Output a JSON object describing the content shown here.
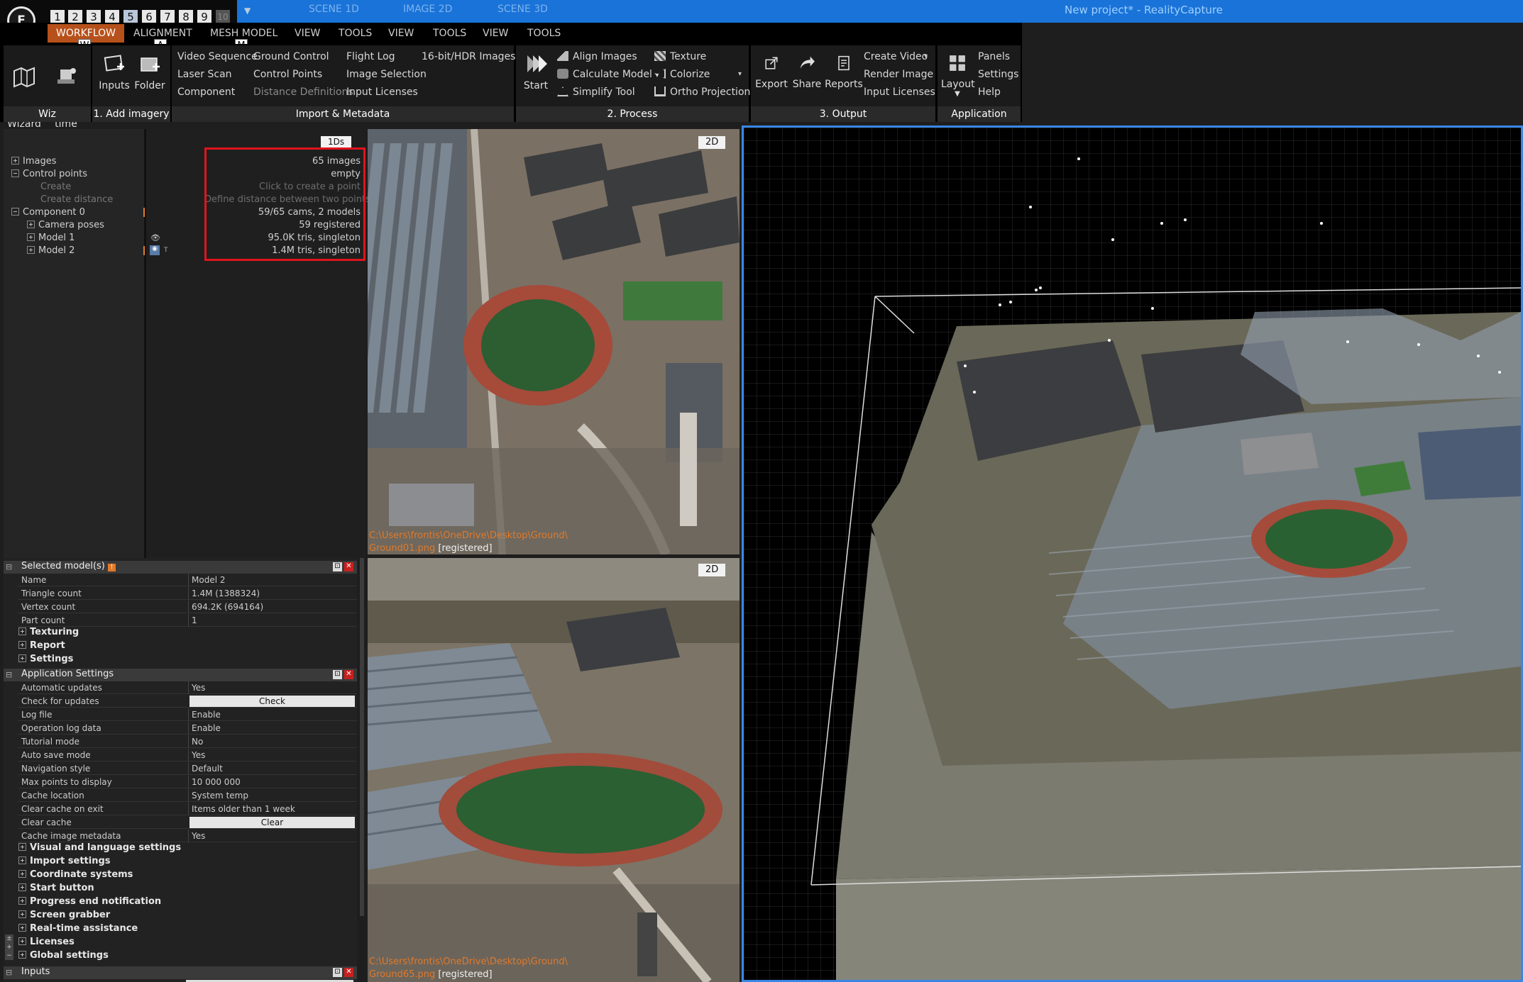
{
  "titlebar": {
    "logo": "F",
    "layout_tabs": [
      "1",
      "2",
      "3",
      "4",
      "5",
      "6",
      "7",
      "8",
      "9",
      "10"
    ],
    "scene_tabs": [
      "SCENE 1D",
      "IMAGE 2D",
      "SCENE 3D"
    ],
    "window_title": "New project* - RealityCapture"
  },
  "menubar": {
    "items": [
      "WORKFLOW",
      "ALIGNMENT",
      "MESH MODEL",
      "VIEW",
      "TOOLS",
      "VIEW",
      "TOOLS",
      "VIEW",
      "TOOLS"
    ],
    "hotkeys": [
      "W",
      "A",
      "M"
    ]
  },
  "ribbon": {
    "wiz": {
      "map_wizard": "Map\nWizard",
      "realtime_assistance": "Real-time\nAssistance",
      "footer": "Wiz"
    },
    "add_imagery": {
      "inputs": "Inputs",
      "folder": "Folder",
      "footer": "1. Add imagery"
    },
    "import_metadata": {
      "col1": [
        "Video Sequence",
        "Laser Scan",
        "Component"
      ],
      "col2": [
        "Ground Control",
        "Control Points",
        "Distance Definitions"
      ],
      "col3": [
        "Flight Log",
        "Image Selection",
        "Input Licenses"
      ],
      "col4": [
        "16-bit/HDR Images"
      ],
      "footer": "Import & Metadata"
    },
    "process": {
      "start": "Start",
      "col1": [
        "Align Images",
        "Calculate Model",
        "Simplify Tool"
      ],
      "col2": [
        "Texture",
        "Colorize",
        "Ortho Projection"
      ],
      "footer": "2. Process"
    },
    "output": {
      "export": "Export",
      "share": "Share",
      "reports": "Reports",
      "col": [
        "Create Video",
        "Render Image",
        "Input Licenses"
      ],
      "footer": "3. Output"
    },
    "application": {
      "layout": "Layout",
      "col": [
        "Panels",
        "Settings",
        "Help"
      ],
      "footer": "Application"
    }
  },
  "tree": {
    "tab": "1Ds",
    "rows": [
      {
        "label": "Images",
        "value": "65 images"
      },
      {
        "label": "Control points",
        "value": "empty"
      },
      {
        "label": "Create",
        "value": "Click to create a point"
      },
      {
        "label": "Create distance",
        "value": "Define distance between two points"
      },
      {
        "label": "Component 0",
        "value": "59/65 cams, 2 models"
      },
      {
        "label": "Camera poses",
        "value": "59 registered"
      },
      {
        "label": "Model 1",
        "value": "95.0K tris, singleton"
      },
      {
        "label": "Model 2",
        "value": "1.4M tris, singleton"
      }
    ]
  },
  "selected_model": {
    "title": "Selected model(s)",
    "rows": [
      {
        "key": "Name",
        "value": "Model 2"
      },
      {
        "key": "Triangle count",
        "value": "1.4M (1388324)"
      },
      {
        "key": "Vertex count",
        "value": "694.2K (694164)"
      },
      {
        "key": "Part count",
        "value": "1"
      }
    ],
    "sections": [
      "Texturing",
      "Report",
      "Settings"
    ]
  },
  "app_settings": {
    "title": "Application Settings",
    "rows": [
      {
        "key": "Automatic updates",
        "value": "Yes"
      },
      {
        "key": "Check for updates",
        "value": "Check",
        "button": true
      },
      {
        "key": "Log file",
        "value": "Enable"
      },
      {
        "key": "Operation log data",
        "value": "Enable"
      },
      {
        "key": "Tutorial mode",
        "value": "No"
      },
      {
        "key": "Auto save mode",
        "value": "Yes"
      },
      {
        "key": "Navigation style",
        "value": "Default"
      },
      {
        "key": "Max points to display",
        "value": "10 000 000"
      },
      {
        "key": "Cache location",
        "value": "System temp"
      },
      {
        "key": "Clear cache on exit",
        "value": "Items older than 1 week"
      },
      {
        "key": "Clear cache",
        "value": "Clear",
        "button": true
      },
      {
        "key": "Cache image metadata",
        "value": "Yes"
      }
    ],
    "sections": [
      "Visual and language settings",
      "Import settings",
      "Coordinate systems",
      "Start button",
      "Progress end notification",
      "Screen grabber",
      "Real-time assistance",
      "Licenses",
      "Global settings"
    ]
  },
  "inputs_panel": {
    "title": "Inputs"
  },
  "image_views": [
    {
      "badge": "2D",
      "path": "C:\\Users\\frontis\\OneDrive\\Desktop\\Ground\\",
      "file": "Ground01.png",
      "status": "[registered]"
    },
    {
      "badge": "2D",
      "path": "C:\\Users\\frontis\\OneDrive\\Desktop\\Ground\\",
      "file": "Ground65.png",
      "status": "[registered]"
    }
  ],
  "colors": {
    "accent_blue": "#1a73d8",
    "workflow_orange": "#b7511b",
    "highlight_red": "#e0141e",
    "path_orange": "#e07a2a"
  }
}
